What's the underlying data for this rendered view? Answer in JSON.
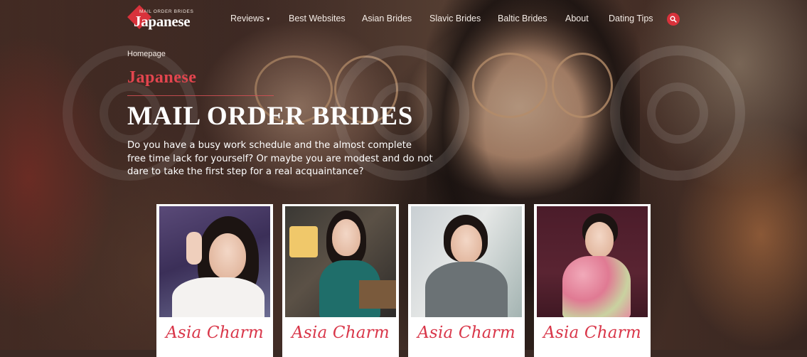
{
  "header": {
    "logo_top": "MAIL ORDER BRIDES",
    "logo_main": "Japanese",
    "nav": [
      {
        "label": "Reviews",
        "has_dropdown": true
      },
      {
        "label": "Best Websites"
      },
      {
        "label": "Asian Brides"
      },
      {
        "label": "Slavic Brides"
      },
      {
        "label": "Baltic Brides"
      },
      {
        "label": "About"
      },
      {
        "label": "Dating Tips"
      }
    ],
    "search_icon": "search-icon",
    "caret": "▾"
  },
  "hero": {
    "breadcrumb": "Homepage",
    "subtitle": "Japanese",
    "title": "MAIL ORDER BRIDES",
    "description": "Do you have a busy work schedule and the almost complete free time lack for yourself? Or maybe you are modest and do not dare to take the first step for a real acquaintance?"
  },
  "cards": [
    {
      "brand": "Asia Charm"
    },
    {
      "brand": "Asia Charm"
    },
    {
      "brand": "Asia Charm"
    },
    {
      "brand": "Asia Charm"
    }
  ],
  "colors": {
    "accent": "#d8323b",
    "brand_script": "#d9374a",
    "subtitle": "#e3454e"
  }
}
